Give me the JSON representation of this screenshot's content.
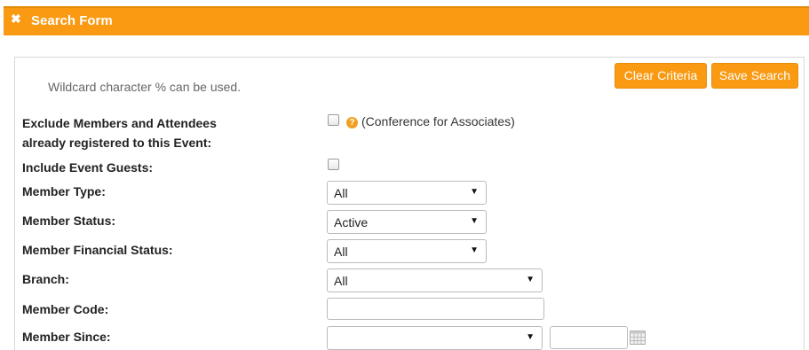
{
  "header": {
    "close_icon": "close-icon",
    "title": "Search Form"
  },
  "hint": "Wildcard character % can be used.",
  "buttons": {
    "clear": "Clear Criteria",
    "save": "Save Search"
  },
  "colors": {
    "accent": "#f99a12"
  },
  "fields": {
    "exclude": {
      "label_line1": "Exclude Members and Attendees",
      "label_line2": "already registered to this Event:",
      "checked": false,
      "note": "(Conference for Associates)",
      "help_icon": "question-circle-icon"
    },
    "guests": {
      "label": "Include Event Guests:",
      "checked": false
    },
    "member_type": {
      "label": "Member Type:",
      "value": "All"
    },
    "member_status": {
      "label": "Member Status:",
      "value": "Active"
    },
    "financial_status": {
      "label": "Member Financial Status:",
      "value": "All"
    },
    "branch": {
      "label": "Branch:",
      "value": "All"
    },
    "member_code": {
      "label": "Member Code:",
      "value": ""
    },
    "member_since": {
      "label": "Member Since:",
      "value": "",
      "date_value": "",
      "calendar_icon": "calendar-icon"
    }
  }
}
